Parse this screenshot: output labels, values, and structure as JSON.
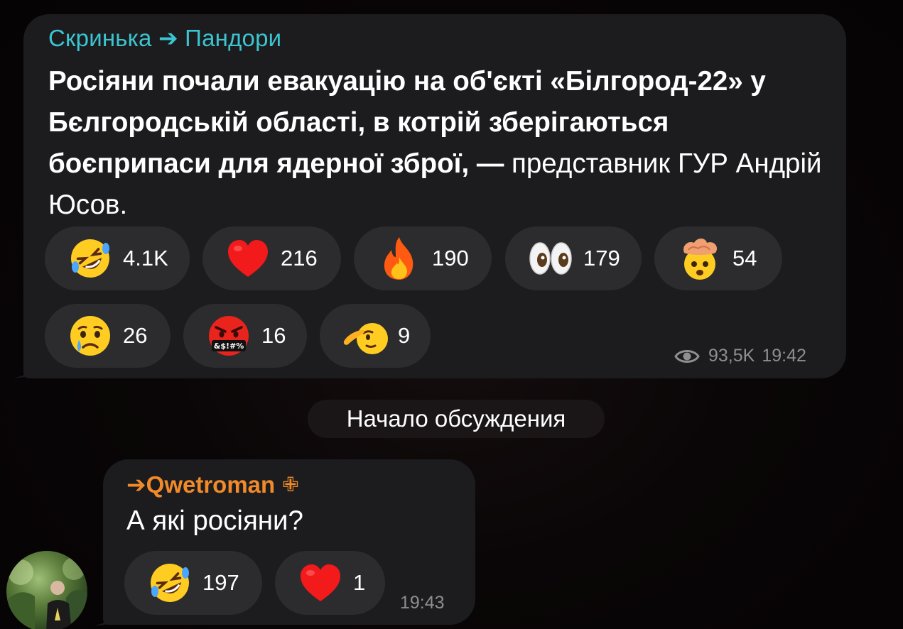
{
  "post": {
    "channel_name": "Скринька ➔ Пандори",
    "text_bold": "Росіяни почали евакуацію на об'єкті «Білгород-22» у Бєлгородській області, в котрій зберігаються боєприпаси для ядерної зброї, —",
    "text_regular": " представник ГУР Андрій Юсов.",
    "reactions": [
      {
        "icon": "rolling-laughing-icon",
        "count": "4.1K"
      },
      {
        "icon": "red-heart-icon",
        "count": "216"
      },
      {
        "icon": "fire-icon",
        "count": "190"
      },
      {
        "icon": "eyes-icon",
        "count": "179"
      },
      {
        "icon": "exploding-head-icon",
        "count": "54"
      },
      {
        "icon": "crying-face-icon",
        "count": "26"
      },
      {
        "icon": "cursing-face-icon",
        "count": "16"
      },
      {
        "icon": "saluting-face-icon",
        "count": "9"
      }
    ],
    "views": "93,5K",
    "time": "19:42"
  },
  "service_message": "Начало обсуждения",
  "reply": {
    "author": "➔Qwetroman",
    "author_badge": "✙",
    "text": "А які росіяни?",
    "reactions": [
      {
        "icon": "rolling-laughing-icon",
        "count": "197"
      },
      {
        "icon": "red-heart-icon",
        "count": "1"
      }
    ],
    "time": "19:43"
  },
  "colors": {
    "bubble": "#1c1c1e",
    "pill": "#2c2c2e",
    "channel_name": "#3cc4d0",
    "author_name": "#f08a2a",
    "meta": "#8e8e93",
    "background": "#060405"
  }
}
